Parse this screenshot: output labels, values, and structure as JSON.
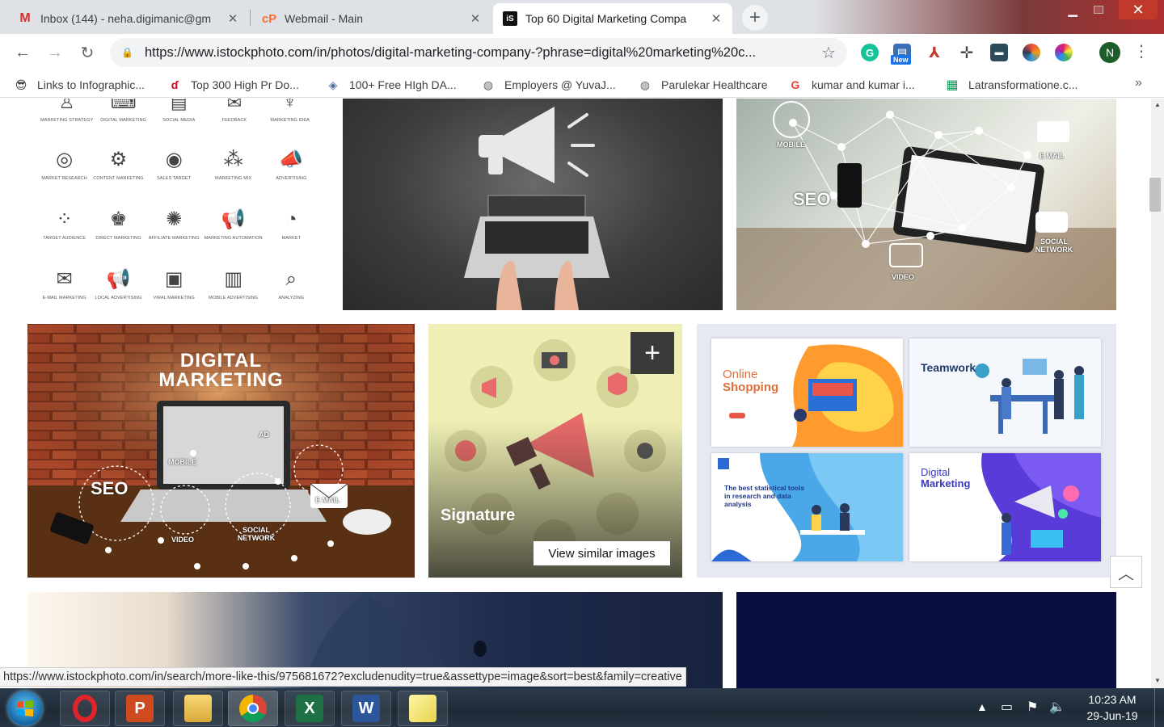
{
  "browser": {
    "tabs": [
      {
        "title": "Inbox (144) - neha.digimanic@gm",
        "icon": "gmail-icon",
        "active": false
      },
      {
        "title": "Webmail - Main",
        "icon": "cpanel-icon",
        "active": false
      },
      {
        "title": "Top 60 Digital Marketing Compa",
        "icon": "istock-icon",
        "active": true
      }
    ],
    "new_tab_label": "+",
    "address": {
      "url": "https://www.istockphoto.com/in/photos/digital-marketing-company-?phrase=digital%20marketing%20c..."
    },
    "extensions": [
      "grammarly-icon",
      "new-badge-extension-icon",
      "pdf-icon",
      "move-icon",
      "folder-icon",
      "color-wheel-icon",
      "chromatic-icon"
    ],
    "new_badge": "New",
    "profile_initial": "N",
    "colors": {
      "accent_blue": "#1a73e8",
      "tab_strip": "#dee1e6",
      "omnibox": "#f1f3f4"
    }
  },
  "bookmarks": [
    {
      "label": "Links to Infographic...",
      "icon": "sunglasses-emoji-icon"
    },
    {
      "label": "Top 300 High Pr Do...",
      "icon": "red-bolt-icon"
    },
    {
      "label": "100+ Free HIgh DA...",
      "icon": "diamond-icon"
    },
    {
      "label": "Employers @ YuvaJ...",
      "icon": "globe-icon"
    },
    {
      "label": "Parulekar Healthcare",
      "icon": "globe-icon"
    },
    {
      "label": "kumar and kumar i...",
      "icon": "google-icon"
    },
    {
      "label": "Latransformatione.c...",
      "icon": "sheets-icon"
    }
  ],
  "page": {
    "icon_grid": {
      "captions": [
        "MARKETING STRATEGY",
        "DIGITAL MARKETING",
        "SOCIAL MEDIA",
        "FEEDBACK",
        "MARKETING IDEA",
        "MARKET RESEARCH",
        "CONTENT MARKETING",
        "SALES TARGET",
        "MARKETING MIX",
        "ADVERTISING",
        "TARGET AUDIENCE",
        "DIRECT MARKETING",
        "AFFILIATE MARKETING",
        "MARKETING AUTOMATION",
        "MARKET",
        "E-MAIL MARKETING",
        "LOCAL ADVERTISING",
        "VIRAL MARKETING",
        "MOBILE ADVERTISING",
        "ANALYZING"
      ]
    },
    "tablet_photo": {
      "labels": [
        "MOBILE",
        "E MAIL",
        "SEO",
        "SOCIAL NETWORK",
        "VIDEO"
      ]
    },
    "brick_photo": {
      "heading_line1": "DIGITAL",
      "heading_line2": "MARKETING",
      "labels": [
        "SEO",
        "MOBILE",
        "AD",
        "E MAIL",
        "VIDEO",
        "SOCIAL NETWORK"
      ]
    },
    "hover_tile": {
      "add_label": "+",
      "collection_label": "Signature",
      "similar_button": "View similar images"
    },
    "illustration_tile": {
      "cards": [
        {
          "title_a": "Online",
          "title_b": "Shopping"
        },
        {
          "title_a": "Teamwork",
          "title_b": ""
        },
        {
          "title_a": "The best statistical tools in research and data analysis",
          "title_b": ""
        },
        {
          "title_a": "Digital",
          "title_b": "Marketing"
        }
      ]
    },
    "back_to_top": "︿",
    "status_url": "https://www.istockphoto.com/in/search/more-like-this/975681672?excludenudity=true&assettype=image&sort=best&family=creative"
  },
  "taskbar": {
    "apps": [
      "opera-icon",
      "powerpoint-icon",
      "file-explorer-icon",
      "chrome-icon",
      "excel-icon",
      "word-icon",
      "sticky-notes-icon"
    ],
    "clock_time": "10:23 AM",
    "clock_date": "29-Jun-19"
  }
}
